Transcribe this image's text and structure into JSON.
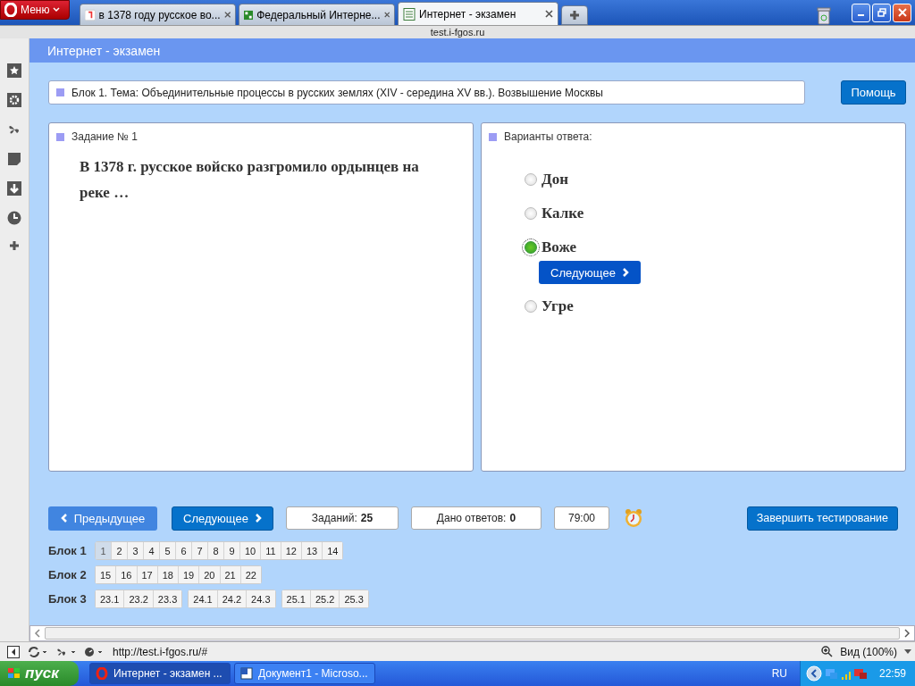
{
  "browser": {
    "menu_label": "Меню",
    "tabs": [
      {
        "title": "в 1378 году русское во...",
        "selected": false,
        "kind": "search"
      },
      {
        "title": "Федеральный Интерне...",
        "selected": false,
        "kind": "site"
      },
      {
        "title": "Интернет - экзамен",
        "selected": true,
        "kind": "page"
      }
    ],
    "host": "test.i-fgos.ru",
    "status_url": "http://test.i-fgos.ru/#",
    "zoom_label": "Вид (100%)"
  },
  "page": {
    "title": "Интернет - экзамен",
    "block_title": "Блок 1. Тема: Объединительные процессы в русских землях (XIV - середина XV вв.). Возвышение Москвы",
    "help_button": "Помощь",
    "question": {
      "heading": "Задание № 1",
      "text": "В 1378 г. русское войско разгромило ордынцев на реке …"
    },
    "answers": {
      "heading": "Варианты ответа:",
      "inline_next": "Следующее",
      "options": [
        {
          "label": "Дон",
          "selected": false
        },
        {
          "label": "Калке",
          "selected": false
        },
        {
          "label": "Воже",
          "selected": true
        },
        {
          "label": "Угре",
          "selected": false
        }
      ]
    },
    "nav": {
      "prev": "Предыдущее",
      "next": "Следующее",
      "total_label": "Заданий:",
      "total": "25",
      "answered_label": "Дано ответов:",
      "answered": "0",
      "timer": "79:00",
      "finish": "Завершить тестирование"
    },
    "blocks": [
      {
        "label": "Блок 1",
        "groups": [
          [
            {
              "n": "1",
              "selected": true
            },
            {
              "n": "2",
              "selected": false
            },
            {
              "n": "3",
              "selected": false
            },
            {
              "n": "4",
              "selected": false
            },
            {
              "n": "5",
              "selected": false
            },
            {
              "n": "6",
              "selected": false
            },
            {
              "n": "7",
              "selected": false
            },
            {
              "n": "8",
              "selected": false
            },
            {
              "n": "9",
              "selected": false
            },
            {
              "n": "10",
              "selected": false
            },
            {
              "n": "11",
              "selected": false
            },
            {
              "n": "12",
              "selected": false
            },
            {
              "n": "13",
              "selected": false
            },
            {
              "n": "14",
              "selected": false
            }
          ]
        ]
      },
      {
        "label": "Блок 2",
        "groups": [
          [
            {
              "n": "15",
              "selected": false
            },
            {
              "n": "16",
              "selected": false
            },
            {
              "n": "17",
              "selected": false
            },
            {
              "n": "18",
              "selected": false
            },
            {
              "n": "19",
              "selected": false
            },
            {
              "n": "20",
              "selected": false
            },
            {
              "n": "21",
              "selected": false
            },
            {
              "n": "22",
              "selected": false
            }
          ]
        ]
      },
      {
        "label": "Блок 3",
        "groups": [
          [
            {
              "n": "23.1",
              "selected": false
            },
            {
              "n": "23.2",
              "selected": false
            },
            {
              "n": "23.3",
              "selected": false
            }
          ],
          [
            {
              "n": "24.1",
              "selected": false
            },
            {
              "n": "24.2",
              "selected": false
            },
            {
              "n": "24.3",
              "selected": false
            }
          ],
          [
            {
              "n": "25.1",
              "selected": false
            },
            {
              "n": "25.2",
              "selected": false
            },
            {
              "n": "25.3",
              "selected": false
            }
          ]
        ]
      }
    ]
  },
  "taskbar": {
    "start": "пуск",
    "windows": [
      {
        "title": "Интернет - экзамен ...",
        "selected": true,
        "kind": "browser"
      },
      {
        "title": "Документ1 - Microso...",
        "selected": false,
        "kind": "document"
      }
    ],
    "language": "RU",
    "clock": "22:59"
  }
}
